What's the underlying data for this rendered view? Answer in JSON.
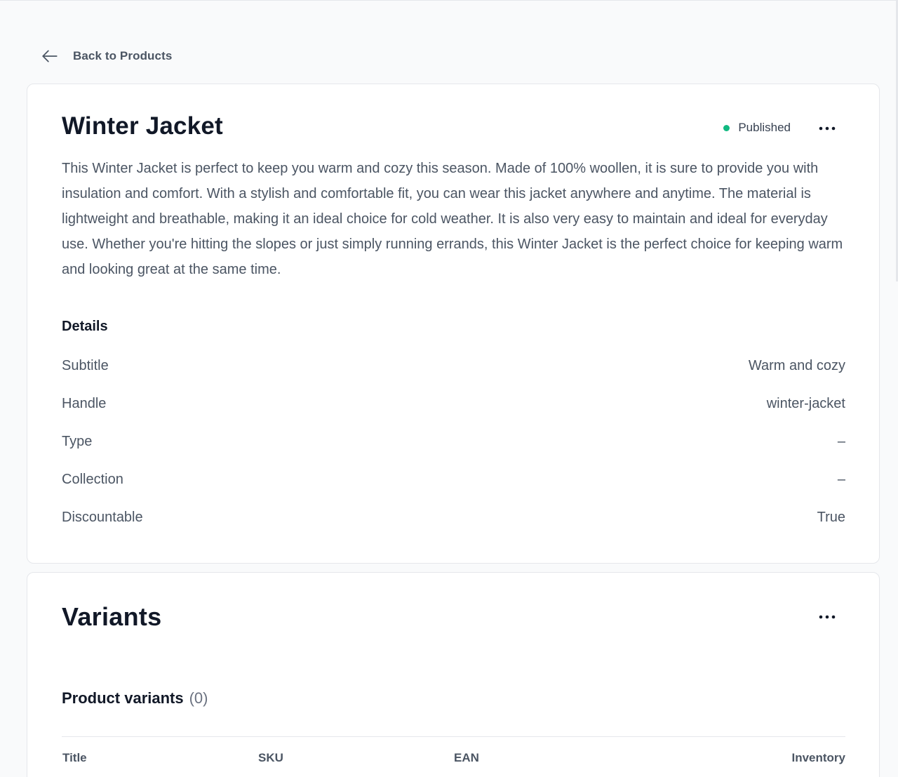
{
  "nav": {
    "back_label": "Back to Products"
  },
  "product": {
    "title": "Winter Jacket",
    "status_label": "Published",
    "status_color": "#10b981",
    "description": "This Winter Jacket is perfect to keep you warm and cozy this season. Made of 100% woollen, it is sure to provide you with insulation and comfort. With a stylish and comfortable fit, you can wear this jacket anywhere and anytime. The material is lightweight and breathable, making it an ideal choice for cold weather. It is also very easy to maintain and ideal for everyday use. Whether you're hitting the slopes or just simply running errands, this Winter Jacket is the perfect choice for keeping warm and looking great at the same time.",
    "details_heading": "Details",
    "details": [
      {
        "label": "Subtitle",
        "value": "Warm and cozy"
      },
      {
        "label": "Handle",
        "value": "winter-jacket"
      },
      {
        "label": "Type",
        "value": "–"
      },
      {
        "label": "Collection",
        "value": "–"
      },
      {
        "label": "Discountable",
        "value": "True"
      }
    ]
  },
  "variants": {
    "title": "Variants",
    "list_heading": "Product variants",
    "count": "(0)",
    "columns": {
      "title": "Title",
      "sku": "SKU",
      "ean": "EAN",
      "inventory": "Inventory"
    }
  },
  "icons": {
    "back": "arrow-left-icon",
    "more": "more-horizontal-icon"
  }
}
